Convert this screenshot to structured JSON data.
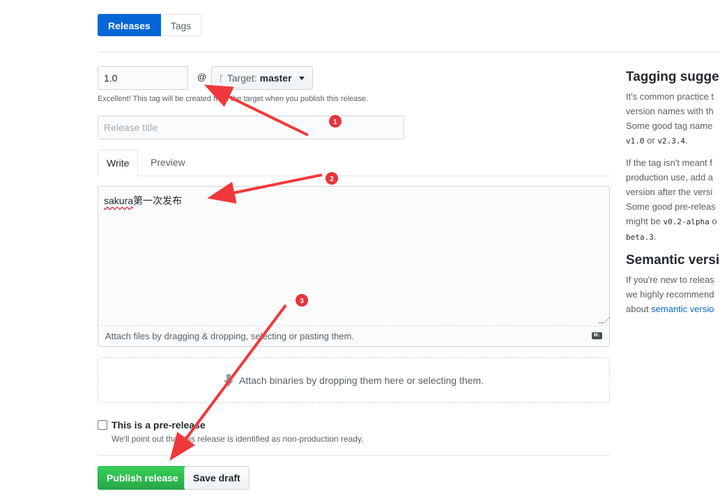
{
  "tabnav": {
    "releases": "Releases",
    "tags": "Tags"
  },
  "tag": {
    "value": "1.0",
    "at": "@",
    "target_label": "Target:",
    "target_value": "master",
    "hint": "Excellent! This tag will be created from the target when you publish this release."
  },
  "release_title": {
    "placeholder": "Release title"
  },
  "editor": {
    "tab_write": "Write",
    "tab_preview": "Preview",
    "content_prefix": "sakura",
    "content_rest": "第一次发布",
    "attach_hint": "Attach files by dragging & dropping, selecting or pasting them.",
    "markdown_icon": "M↓"
  },
  "binaries": {
    "text": "Attach binaries by dropping them here or selecting them."
  },
  "prerelease": {
    "label": "This is a pre-release",
    "note": "We'll point out that this release is identified as non-production ready.",
    "checked": false
  },
  "buttons": {
    "publish": "Publish release",
    "save_draft": "Save draft"
  },
  "sidebar": {
    "tagging_title": "Tagging sugges",
    "tagging_line1": "It's common practice t",
    "tagging_line2": "version names with th",
    "tagging_line3": "Some good tag name",
    "code_v1": "v1.0",
    "or1": " or ",
    "code_v2": "v2.3.4",
    "dot1": ".",
    "pre_line1": "If the tag isn't meant f",
    "pre_line2": "production use, add a",
    "pre_line3": "version after the versi",
    "pre_line4": "Some good pre-releas",
    "pre_line5": "might be ",
    "code_alpha": "v0.2-alpha",
    "or2": " o",
    "code_beta": "beta.3",
    "dot2": ".",
    "semver_title": "Semantic versio",
    "semver_line1": "If you're new to releas",
    "semver_line2": "we highly recommend",
    "semver_line3": "about ",
    "semver_link": "semantic versio"
  },
  "annotations": {
    "badge1": "1",
    "badge2": "2",
    "badge3": "3",
    "arrow_color": "#f0393c"
  }
}
